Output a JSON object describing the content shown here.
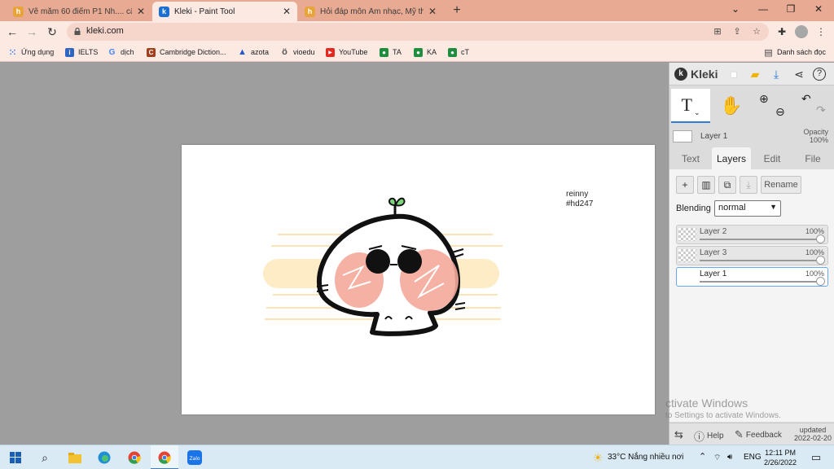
{
  "browser": {
    "tabs": [
      {
        "title": "Vẽ mẵm 60 điểm P1 Nh.... câu hỏ",
        "favicon_color": "#e8a33a",
        "active": false
      },
      {
        "title": "Kleki - Paint Tool",
        "favicon_color": "#1a6fd3",
        "active": true
      },
      {
        "title": "Hỏi đáp môn Âm nhạc, Mỹ thuật,",
        "favicon_color": "#e8a33a",
        "active": false
      }
    ],
    "new_tab": "+",
    "window_controls": [
      "⌄",
      "—",
      "❐",
      "✕"
    ],
    "url": "kleki.com",
    "bookmarks": [
      {
        "label": "Ứng dụng",
        "icon": "apps-grid-icon"
      },
      {
        "label": "IELTS",
        "icon": "ielts-icon"
      },
      {
        "label": "dịch",
        "icon": "google-icon"
      },
      {
        "label": "Cambridge Diction...",
        "icon": "cambridge-icon"
      },
      {
        "label": "azota",
        "icon": "azota-icon"
      },
      {
        "label": "vioedu",
        "icon": "vioedu-icon"
      },
      {
        "label": "YouTube",
        "icon": "youtube-icon"
      },
      {
        "label": "TA",
        "icon": "classroom-icon"
      },
      {
        "label": "KA",
        "icon": "classroom-icon"
      },
      {
        "label": "cT",
        "icon": "classroom-icon"
      }
    ],
    "reading_list": "Danh sách đọc"
  },
  "canvas": {
    "note_line1": "reinny",
    "note_line2": "#hd247"
  },
  "kleki": {
    "logo": "Kleki",
    "active_tool": "T",
    "top_layer": {
      "name": "Layer 1",
      "opacity_label": "Opacity",
      "opacity_value": "100%"
    },
    "tabs": [
      "Text",
      "Layers",
      "Edit",
      "File"
    ],
    "active_tab": "Layers",
    "buttons": {
      "add": "+",
      "delete": "🗑",
      "duplicate": "⧉",
      "merge": "⤓",
      "rename": "Rename"
    },
    "blending_label": "Blending",
    "blending_value": "normal",
    "layers": [
      {
        "name": "Layer 2",
        "opacity": "100%",
        "active": false
      },
      {
        "name": "Layer 3",
        "opacity": "100%",
        "active": false
      },
      {
        "name": "Layer 1",
        "opacity": "100%",
        "active": true
      }
    ],
    "watermark_line1": "ctivate Windows",
    "watermark_line2": "to Settings to activate Windows.",
    "help": "Help",
    "feedback": "Feedback",
    "updated_label": "updated",
    "updated_date": "2022-02-20"
  },
  "taskbar": {
    "weather": "33°C  Nắng nhiều nơi",
    "language": "ENG",
    "time": "12:11 PM",
    "date": "2/26/2022"
  }
}
